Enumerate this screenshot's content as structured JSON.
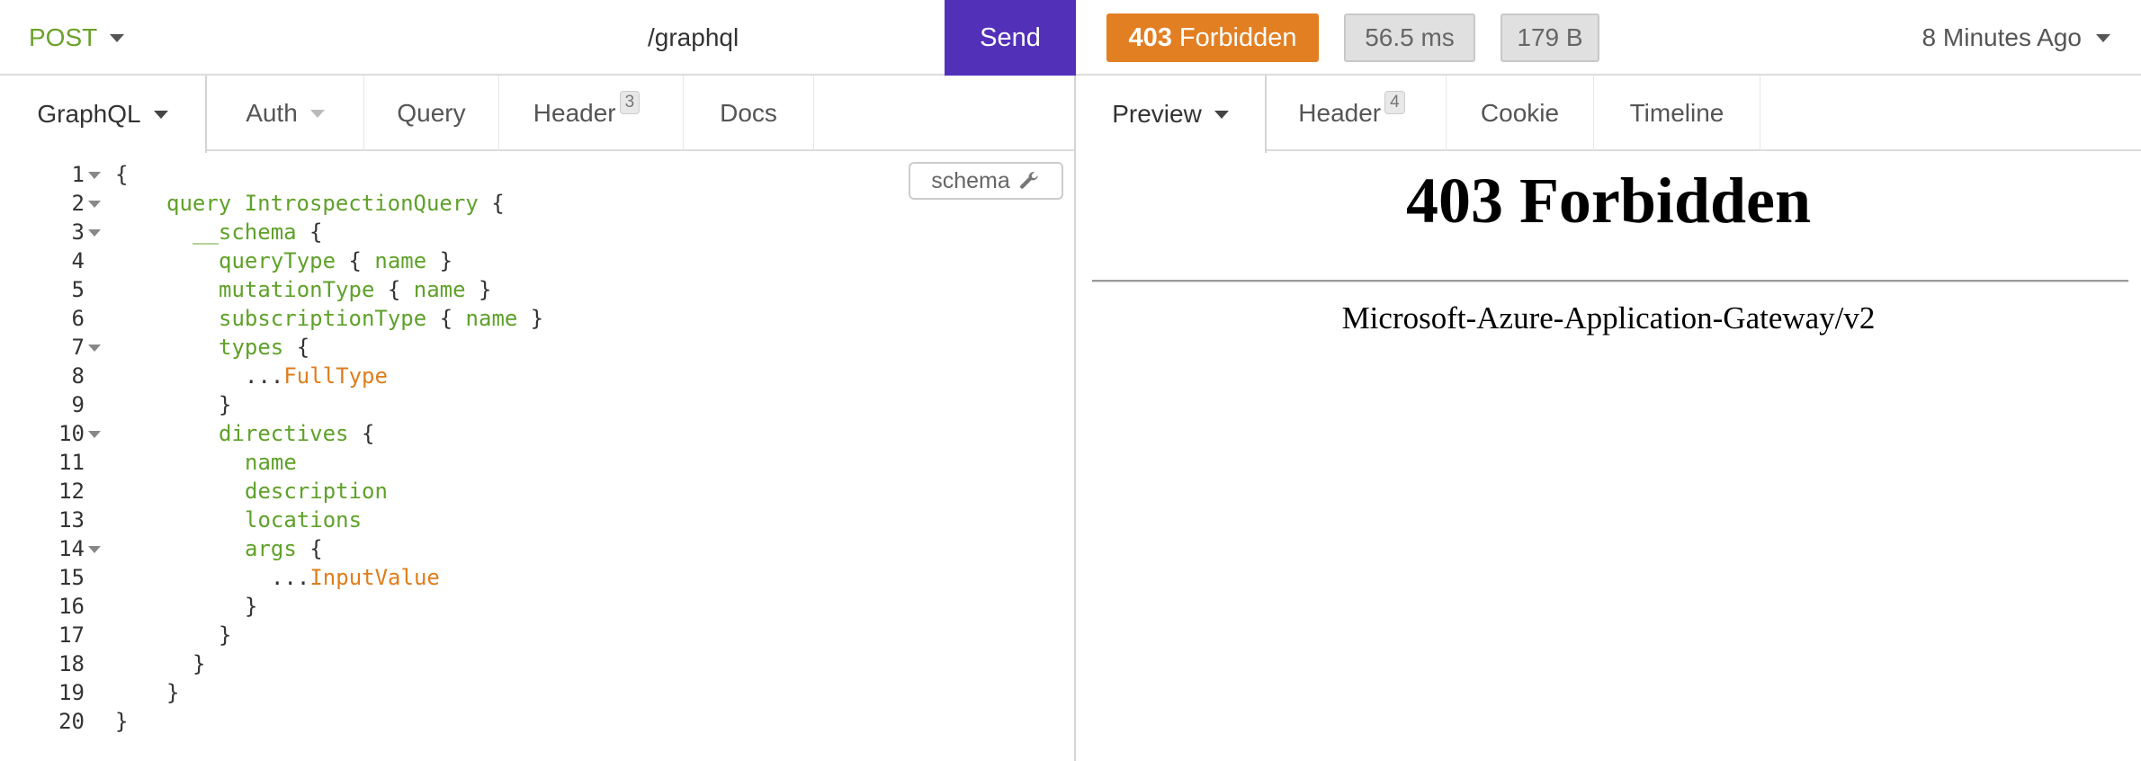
{
  "request": {
    "method": "POST",
    "url": "/graphql",
    "send_label": "Send",
    "tabs": [
      {
        "label": "GraphQL",
        "active": true
      },
      {
        "label": "Auth"
      },
      {
        "label": "Query"
      },
      {
        "label": "Header",
        "badge": "3"
      },
      {
        "label": "Docs"
      }
    ],
    "schema_label": "schema",
    "code_lines": [
      {
        "num": "1",
        "fold": true
      },
      {
        "num": "2",
        "fold": true
      },
      {
        "num": "3",
        "fold": true
      },
      {
        "num": "4"
      },
      {
        "num": "5"
      },
      {
        "num": "6"
      },
      {
        "num": "7",
        "fold": true
      },
      {
        "num": "8"
      },
      {
        "num": "9"
      },
      {
        "num": "10",
        "fold": true
      },
      {
        "num": "11"
      },
      {
        "num": "12"
      },
      {
        "num": "13"
      },
      {
        "num": "14",
        "fold": true
      },
      {
        "num": "15"
      },
      {
        "num": "16"
      },
      {
        "num": "17"
      },
      {
        "num": "18"
      },
      {
        "num": "19"
      },
      {
        "num": "20"
      }
    ],
    "code": {
      "l1": "{",
      "l2_kw": "query IntrospectionQuery",
      "l2_p": " {",
      "l3_kw": "__schema",
      "l3_p": " {",
      "l4_a": "queryType",
      "l4_b": " { ",
      "l4_c": "name",
      "l4_d": " }",
      "l5_a": "mutationType",
      "l5_b": " { ",
      "l5_c": "name",
      "l5_d": " }",
      "l6_a": "subscriptionType",
      "l6_b": " { ",
      "l6_c": "name",
      "l6_d": " }",
      "l7_kw": "types",
      "l7_p": " {",
      "l8_p": "...",
      "l8_f": "FullType",
      "l9": "}",
      "l10_kw": "directives",
      "l10_p": " {",
      "l11": "name",
      "l12": "description",
      "l13": "locations",
      "l14_kw": "args",
      "l14_p": " {",
      "l15_p": "...",
      "l15_f": "InputValue",
      "l16": "}",
      "l17": "}",
      "l18": "}",
      "l19": "}",
      "l20": "}"
    }
  },
  "response": {
    "status": "403",
    "status_text": "Forbidden",
    "time": "56.5 ms",
    "size": "179 B",
    "ago": "8 Minutes Ago",
    "tabs": [
      {
        "label": "Preview",
        "active": true
      },
      {
        "label": "Header",
        "badge": "4"
      },
      {
        "label": "Cookie"
      },
      {
        "label": "Timeline"
      }
    ],
    "preview_title": "403 Forbidden",
    "preview_server": "Microsoft-Azure-Application-Gateway/v2"
  },
  "colors": {
    "accent": "#5230b8",
    "status_error": "#e37f23",
    "method": "#6aa12a",
    "code_keyword": "#5fa12a",
    "code_fragment": "#e07d1c"
  }
}
